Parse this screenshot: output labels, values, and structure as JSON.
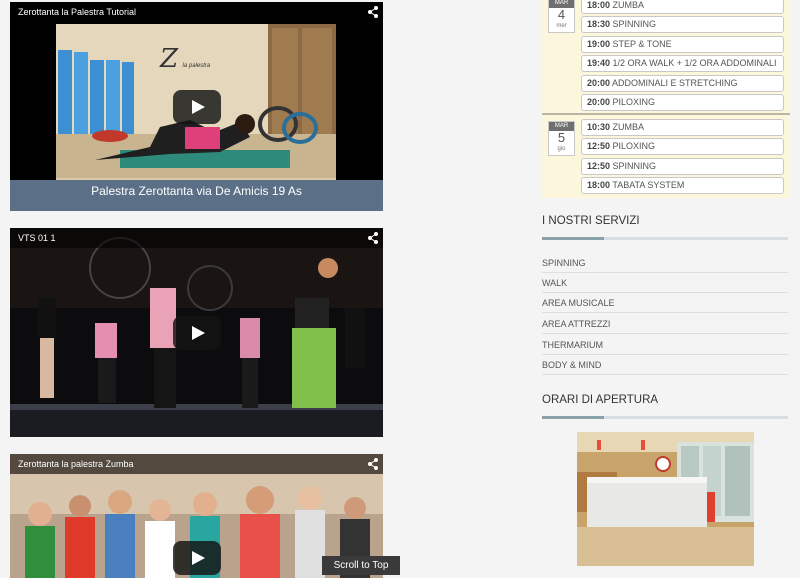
{
  "videos": [
    {
      "title": "Zerottanta la Palestra Tutorial",
      "caption": "Palestra Zerottanta via De Amicis 19 As",
      "logo_letter": "Z",
      "logo_text": "la palestra"
    },
    {
      "title": "VTS 01 1"
    },
    {
      "title": "Zerottanta la palestra Zumba"
    }
  ],
  "scroll_top_label": "Scroll to Top",
  "calendar": {
    "day1": {
      "month": "MAR",
      "day": "4",
      "weekday": "mer"
    },
    "day2": {
      "month": "MAR",
      "day": "5",
      "weekday": "gio"
    },
    "events_day1": [
      {
        "time": "18:00",
        "name": "ZUMBA"
      },
      {
        "time": "18:30",
        "name": "SPINNING"
      },
      {
        "time": "19:00",
        "name": "STEP & TONE"
      },
      {
        "time": "19:40",
        "name": "1/2 ORA WALK + 1/2 ORA ADDOMINALI"
      },
      {
        "time": "20:00",
        "name": "ADDOMINALI E STRETCHING"
      },
      {
        "time": "20:00",
        "name": "PILOXING"
      }
    ],
    "events_day2": [
      {
        "time": "10:30",
        "name": "ZUMBA"
      },
      {
        "time": "12:50",
        "name": "PILOXING"
      },
      {
        "time": "12:50",
        "name": "SPINNING"
      },
      {
        "time": "18:00",
        "name": "TABATA SYSTEM"
      }
    ]
  },
  "services": {
    "title": "I NOSTRI SERVIZI",
    "items": [
      "SPINNING",
      "WALK",
      "AREA MUSICALE",
      "AREA ATTREZZI",
      "THERMARIUM",
      "BODY & MIND"
    ]
  },
  "hours": {
    "title": "ORARI DI APERTURA"
  },
  "colors": {
    "calendar_bg": "#fcf7dc",
    "accent_line": "#8aa0a9"
  }
}
